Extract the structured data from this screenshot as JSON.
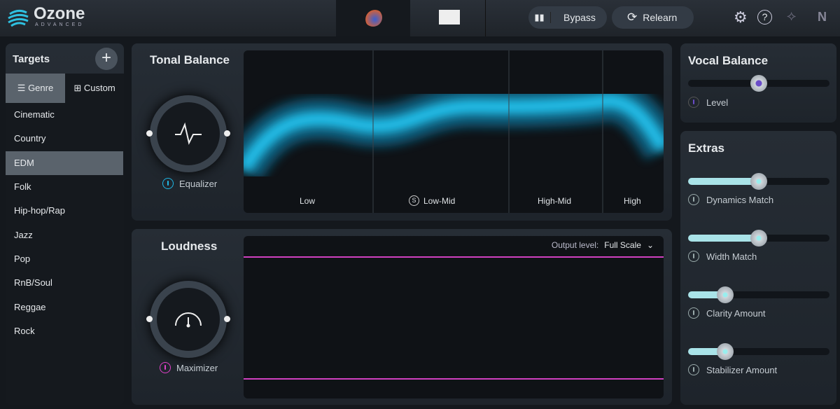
{
  "header": {
    "logo": "Ozone",
    "logo_sub": "ADVANCED",
    "bypass": "Bypass",
    "relearn": "Relearn"
  },
  "targets": {
    "title": "Targets",
    "tabs": [
      "Genre",
      "Custom"
    ],
    "items": [
      "Cinematic",
      "Country",
      "EDM",
      "Folk",
      "Hip-hop/Rap",
      "Jazz",
      "Pop",
      "RnB/Soul",
      "Reggae",
      "Rock"
    ],
    "selected": "EDM"
  },
  "tonal": {
    "title": "Tonal Balance",
    "module": "Equalizer",
    "bands": [
      "Low",
      "Low-Mid",
      "High-Mid",
      "High"
    ],
    "solo_glyph": "S"
  },
  "loudness": {
    "title": "Loudness",
    "module": "Maximizer",
    "output_label": "Output level:",
    "output_value": "Full Scale"
  },
  "vocal": {
    "title": "Vocal Balance",
    "label": "Level",
    "value": 0.5
  },
  "extras": {
    "title": "Extras",
    "sliders": [
      {
        "label": "Dynamics Match",
        "value": 0.5
      },
      {
        "label": "Width Match",
        "value": 0.5
      },
      {
        "label": "Clarity Amount",
        "value": 0.26
      },
      {
        "label": "Stabilizer Amount",
        "value": 0.26
      }
    ]
  },
  "colors": {
    "accent": "#1fb8e6",
    "maximizer": "#e040c8",
    "vocal": "#6a4cc8"
  }
}
